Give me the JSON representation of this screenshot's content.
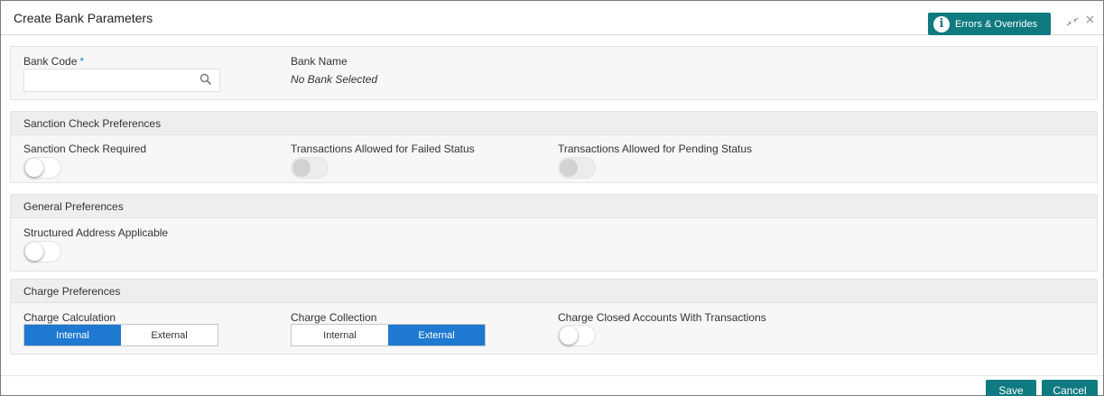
{
  "header": {
    "title": "Create Bank Parameters",
    "errors_button": "Errors & Overrides",
    "errors_icon": "info-icon",
    "minimize_icon": "minimize-icon",
    "close_icon": "close-icon"
  },
  "bank": {
    "code_label": "Bank Code",
    "required_mark": "*",
    "code_value": "",
    "name_label": "Bank Name",
    "name_value": "No Bank Selected"
  },
  "sanction": {
    "title": "Sanction Check Preferences",
    "required_label": "Sanction Check Required",
    "required_on": false,
    "failed_label": "Transactions Allowed for Failed Status",
    "failed_on": false,
    "failed_disabled": true,
    "pending_label": "Transactions Allowed for Pending Status",
    "pending_on": false,
    "pending_disabled": true
  },
  "general": {
    "title": "General Preferences",
    "structured_label": "Structured Address Applicable",
    "structured_on": false
  },
  "charge": {
    "title": "Charge Preferences",
    "calculation_label": "Charge Calculation",
    "calculation_options": [
      "Internal",
      "External"
    ],
    "calculation_selected": "Internal",
    "collection_label": "Charge Collection",
    "collection_options": [
      "Internal",
      "External"
    ],
    "collection_selected": "External",
    "closed_label": "Charge Closed Accounts With Transactions",
    "closed_on": false
  },
  "footer": {
    "save_label": "Save",
    "cancel_label": "Cancel"
  },
  "colors": {
    "teal": "#0f7a80",
    "blue": "#1f79d1",
    "required": "#1a7fd6"
  }
}
